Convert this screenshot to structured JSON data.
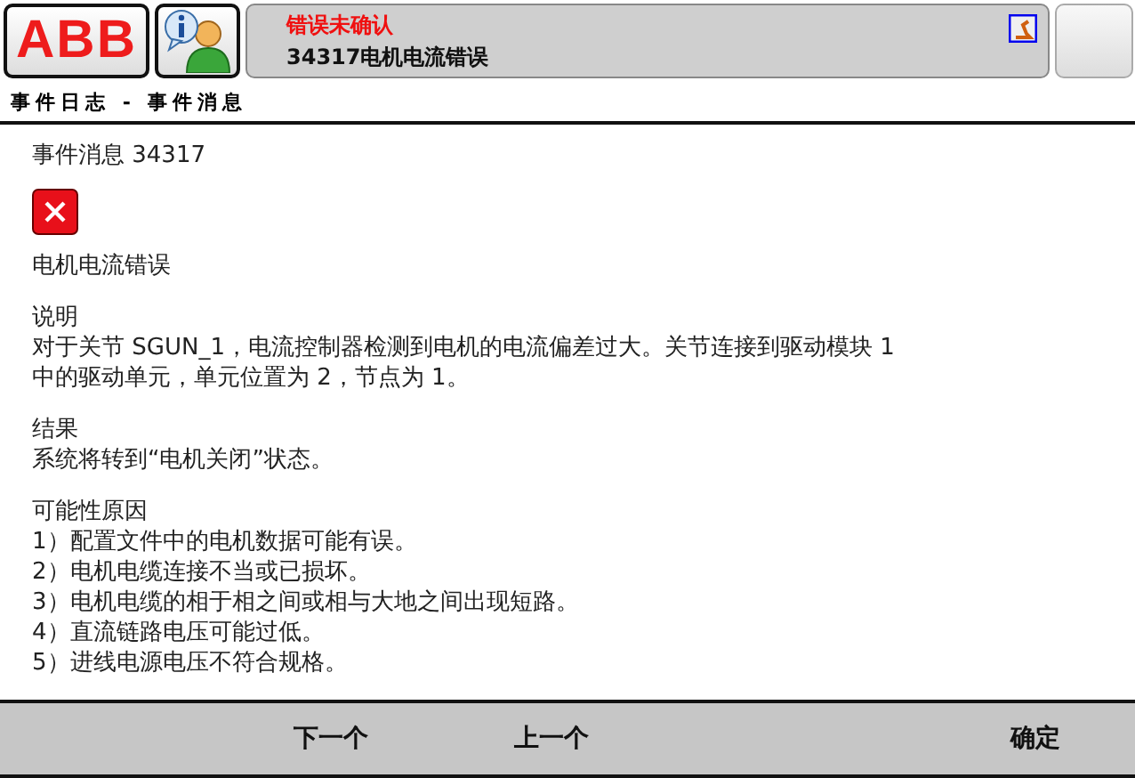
{
  "logo": "ABB",
  "status": {
    "title": "错误未确认",
    "message": "34317电机电流错误"
  },
  "page_title": "事件日志 - 事件消息",
  "event": {
    "heading": "事件消息 34317",
    "title": "电机电流错误",
    "sections": [
      {
        "heading": "说明",
        "text": [
          "对于关节 SGUN_1，电流控制器检测到电机的电流偏差过大。关节连接到驱动模块 1",
          "中的驱动单元，单元位置为 2，节点为 1。"
        ]
      },
      {
        "heading": "结果",
        "text": [
          "系统将转到“电机关闭”状态。"
        ]
      },
      {
        "heading": "可能性原因",
        "items": [
          "1）配置文件中的电机数据可能有误。",
          "2）电机电缆连接不当或已损坏。",
          "3）电机电缆的相于相之间或相与大地之间出现短路。",
          "4）直流链路电压可能过低。",
          "5）进线电源电压不符合规格。"
        ]
      }
    ]
  },
  "buttons": [
    "下一个",
    "上一个",
    "确定"
  ]
}
